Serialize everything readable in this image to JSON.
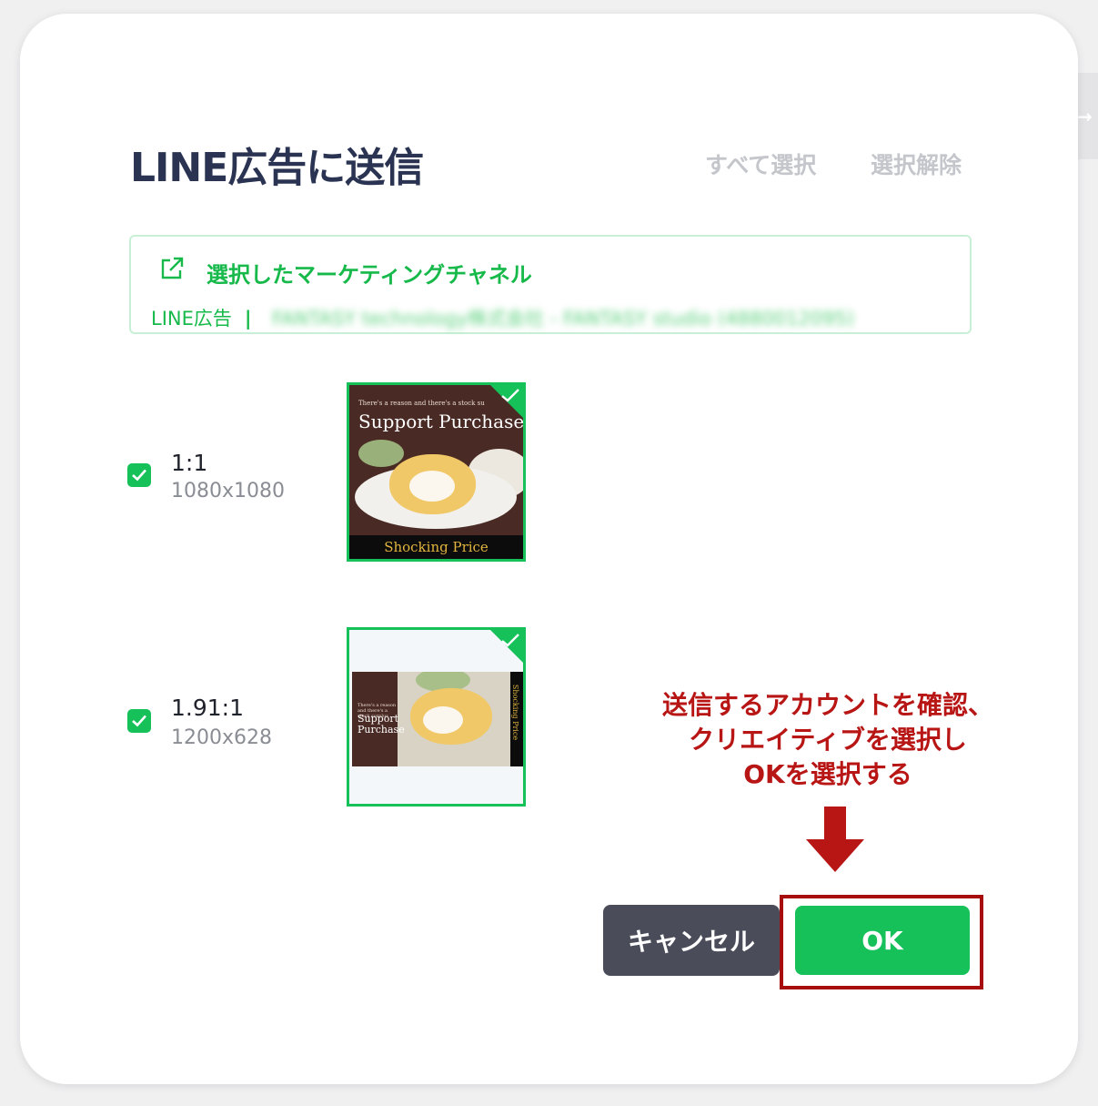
{
  "dialog": {
    "title": "LINE広告に送信",
    "select_all": "すべて選択",
    "deselect_all": "選択解除"
  },
  "channel": {
    "title": "選択したマーケティングチャネル",
    "platform": "LINE広告",
    "separator": "|",
    "account": "FANTASY technology株式会社 - FANTASY studio (4880012095)"
  },
  "creatives": [
    {
      "ratio": "1:1",
      "size": "1080x1080",
      "checked": true,
      "image": {
        "small_text": "There's a reason and there's a stock su",
        "headline": "Support Purchase",
        "footer": "Shocking Price"
      }
    },
    {
      "ratio": "1.91:1",
      "size": "1200x628",
      "checked": true,
      "image": {
        "small_text": "There's a reason and there's a stock surplus",
        "headline": "Support Purchase",
        "footer": "Shocking Price"
      }
    }
  ],
  "annotation": {
    "lines": [
      "送信するアカウントを確認、",
      "クリエイティブを選択し",
      "OKを選択する"
    ],
    "color": "#b81515"
  },
  "buttons": {
    "cancel": "キャンセル",
    "ok": "OK"
  },
  "colors": {
    "accent": "#16c15a",
    "title": "#2a3452",
    "cancel_bg": "#4a4c59",
    "highlight": "#a80d0d"
  }
}
